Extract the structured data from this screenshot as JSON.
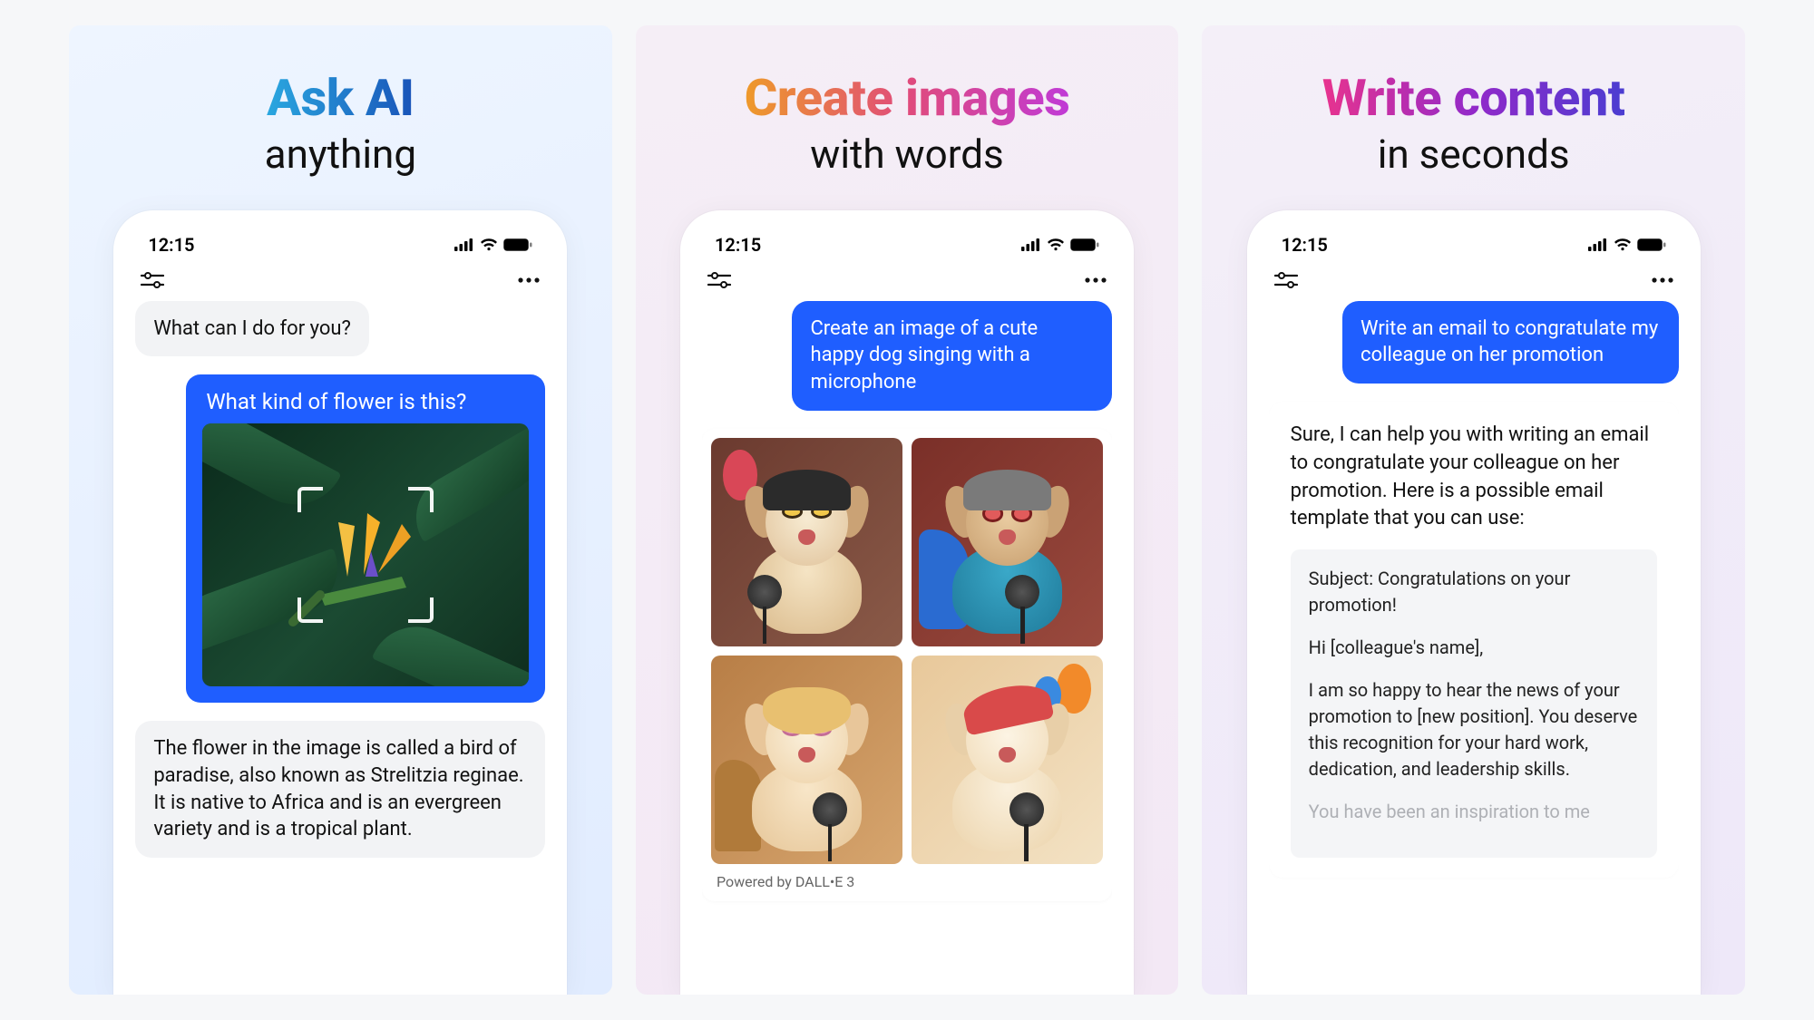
{
  "status": {
    "time": "12:15"
  },
  "panels": [
    {
      "headline_top": "Ask AI",
      "headline_sub": "anything",
      "chat": {
        "ai_greeting": "What can I do for you?",
        "user_question": "What kind of flower is this?",
        "ai_answer": "The flower in the image is called a bird of paradise, also known as Strelitzia reginae. It is native to Africa and is an evergreen variety and is a tropical plant."
      }
    },
    {
      "headline_top": "Create images",
      "headline_sub": "with words",
      "chat": {
        "user_prompt": "Create an image of a cute happy dog singing with a microphone",
        "powered_by": "Powered by DALL•E 3"
      }
    },
    {
      "headline_top": "Write content",
      "headline_sub": "in seconds",
      "chat": {
        "user_prompt": "Write an email to congratulate my colleague on her promotion",
        "ai_intro": "Sure, I can help you with writing an email to congratulate your colleague on her promotion. Here is a possible email template that you can use:",
        "email": {
          "subject": "Subject: Congratulations on your promotion!",
          "greeting": "Hi [colleague's name],",
          "body1": "I am so happy to hear the news of your promotion to [new position]. You deserve this recognition for your hard work, dedication, and leadership skills.",
          "body2": "You have been an inspiration to me"
        }
      }
    }
  ]
}
